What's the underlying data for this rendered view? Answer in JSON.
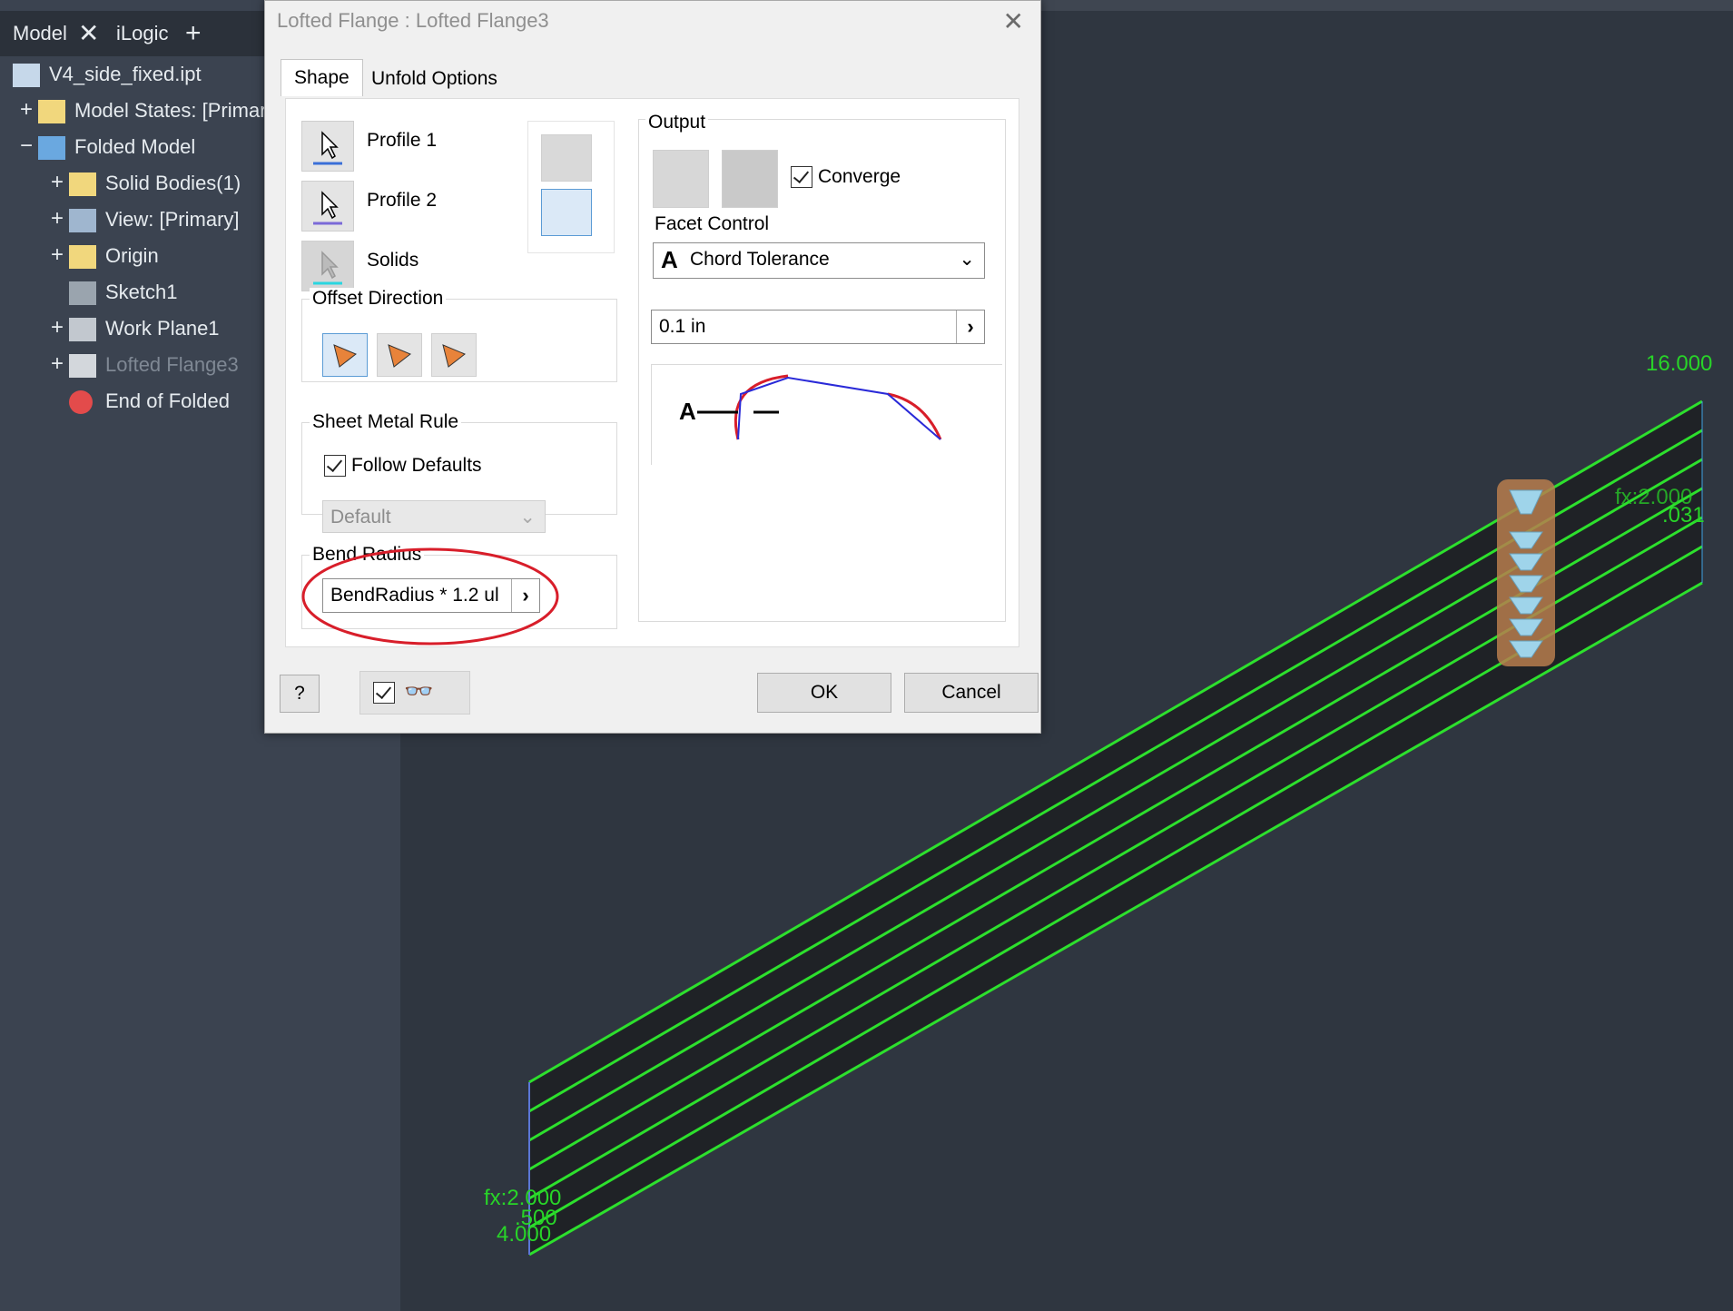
{
  "browser": {
    "tabs": [
      "Model",
      "iLogic"
    ],
    "tree": [
      {
        "label": "V4_side_fixed.ipt",
        "icon": "part-icon",
        "expander": ""
      },
      {
        "label": "Model States: [Primary",
        "icon": "folder-icon",
        "expander": "+"
      },
      {
        "label": "Folded Model",
        "icon": "folded-model-icon",
        "expander": "−"
      },
      {
        "label": "Solid Bodies(1)",
        "icon": "solid-bodies-icon",
        "expander": "+"
      },
      {
        "label": "View: [Primary]",
        "icon": "view-icon",
        "expander": "+"
      },
      {
        "label": "Origin",
        "icon": "folder-icon",
        "expander": "+"
      },
      {
        "label": "Sketch1",
        "icon": "sketch-icon",
        "expander": ""
      },
      {
        "label": "Work Plane1",
        "icon": "work-plane-icon",
        "expander": "+"
      },
      {
        "label": "Lofted Flange3",
        "icon": "lofted-flange-icon",
        "expander": "+"
      },
      {
        "label": "End of Folded",
        "icon": "end-of-folded-icon",
        "expander": ""
      }
    ]
  },
  "dialog": {
    "title": "Lofted Flange : Lofted Flange3",
    "tabs": [
      "Shape",
      "Unfold Options"
    ],
    "profile1": "Profile 1",
    "profile2": "Profile 2",
    "solids": "Solids",
    "offset_direction": "Offset Direction",
    "sheet_metal_rule": "Sheet Metal Rule",
    "follow_defaults": "Follow Defaults",
    "rule_value": "Default",
    "bend_radius": "Bend Radius",
    "bend_radius_value": "BendRadius * 1.2 ul",
    "output": "Output",
    "converge": "Converge",
    "facet_control": "Facet Control",
    "facet_value": "Chord Tolerance",
    "tolerance_value": "0.1 in",
    "ok": "OK",
    "cancel": "Cancel"
  },
  "viewport": {
    "dims": [
      "16.000",
      "fx:2.000",
      ".031",
      "fx:2.000",
      ".500",
      "4.000"
    ]
  },
  "colors": {
    "accent_green": "#28d428",
    "annotation_red": "#d81e2a"
  }
}
